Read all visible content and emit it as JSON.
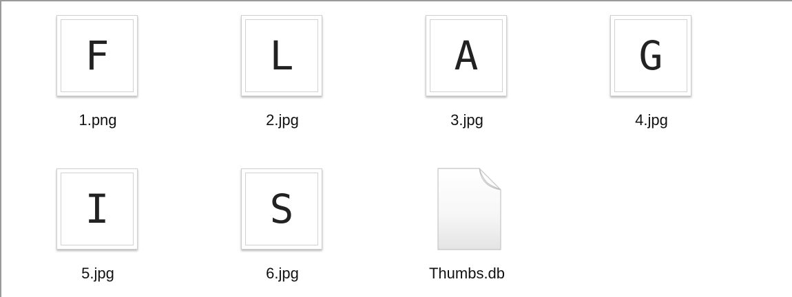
{
  "files": [
    {
      "name": "1.png",
      "kind": "image",
      "letter": "F"
    },
    {
      "name": "2.jpg",
      "kind": "image",
      "letter": "L"
    },
    {
      "name": "3.jpg",
      "kind": "image",
      "letter": "A"
    },
    {
      "name": "4.jpg",
      "kind": "image",
      "letter": "G"
    },
    {
      "name": "5.jpg",
      "kind": "image",
      "letter": "I"
    },
    {
      "name": "6.jpg",
      "kind": "image",
      "letter": "S"
    },
    {
      "name": "Thumbs.db",
      "kind": "document",
      "icon": "blank-document-icon"
    }
  ]
}
